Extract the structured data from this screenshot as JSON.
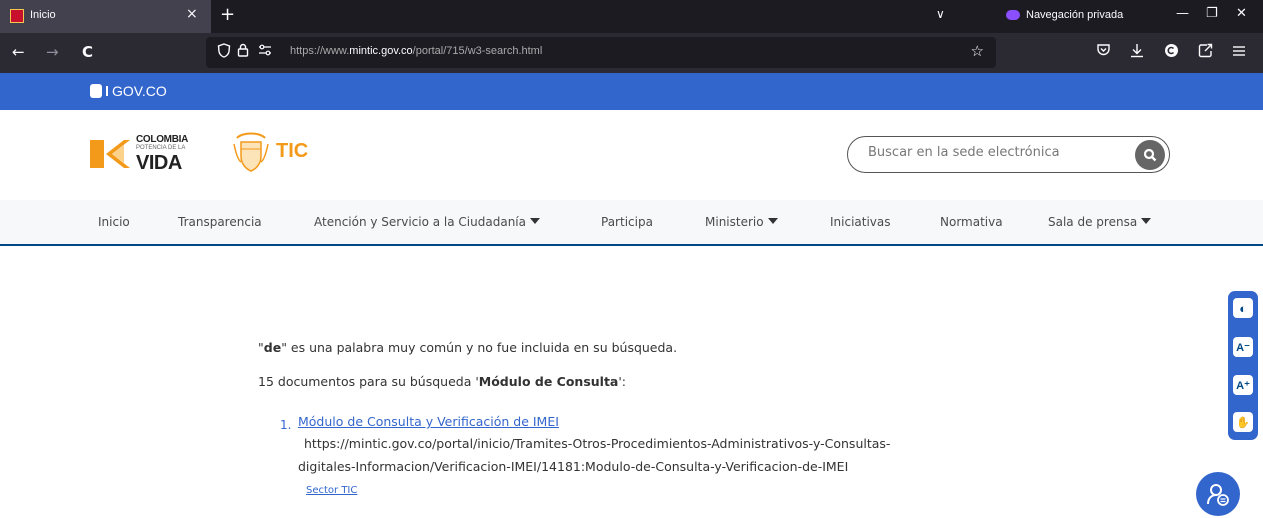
{
  "browser": {
    "tab_title": "Inicio",
    "tab_close": "×",
    "new_tab": "+",
    "tabs_menu": "∨",
    "private_label": "Navegación privada",
    "minimize": "—",
    "restore": "❐",
    "close": "✕",
    "back": "←",
    "forward": "→",
    "reload": "C",
    "url_prefix": "https://www.",
    "url_domain": "mintic.gov.co",
    "url_path": "/portal/715/w3-search.html",
    "bookmark": "☆"
  },
  "gov": {
    "label": "GOV.CO"
  },
  "header": {
    "brand_top": "COLOMBIA",
    "brand_mid": "POTENCIA DE LA",
    "brand_bottom": "VIDA",
    "tic": "TIC"
  },
  "search": {
    "placeholder": "Buscar en la sede electrónica"
  },
  "menu": {
    "items": [
      {
        "label": "Inicio"
      },
      {
        "label": "Transparencia"
      },
      {
        "label": "Atención y Servicio a la Ciudadanía"
      },
      {
        "label": "Participa"
      },
      {
        "label": "Ministerio"
      },
      {
        "label": "Iniciativas"
      },
      {
        "label": "Normativa"
      },
      {
        "label": "Sala de prensa"
      }
    ]
  },
  "results": {
    "note_word": "de",
    "note_rest": " es una palabra muy común y no fue incluida en su búsqueda.",
    "count_prefix": "15 documentos para su búsqueda '",
    "count_query": "Módulo de Consulta",
    "count_suffix": "':",
    "items": [
      {
        "number": "1.",
        "title": "Módulo de Consulta y Verificación de IMEI",
        "url_line1": "https://mintic.gov.co/portal/inicio/Tramites-Otros-Procedimientos-Administrativos-y-Consultas-",
        "url_line2": "digitales-Informacion/Verificacion-IMEI/14181:Modulo-de-Consulta-y-Verificacion-de-IMEI",
        "source": "Sector TIC"
      }
    ]
  },
  "accessibility": {
    "contrast": "◐",
    "decrease": "A⁻",
    "increase": "A⁺",
    "sign": "✋"
  },
  "colors": {
    "gov_blue": "#3366cc",
    "menu_border": "#004884",
    "tic_orange": "#f49a1a"
  }
}
